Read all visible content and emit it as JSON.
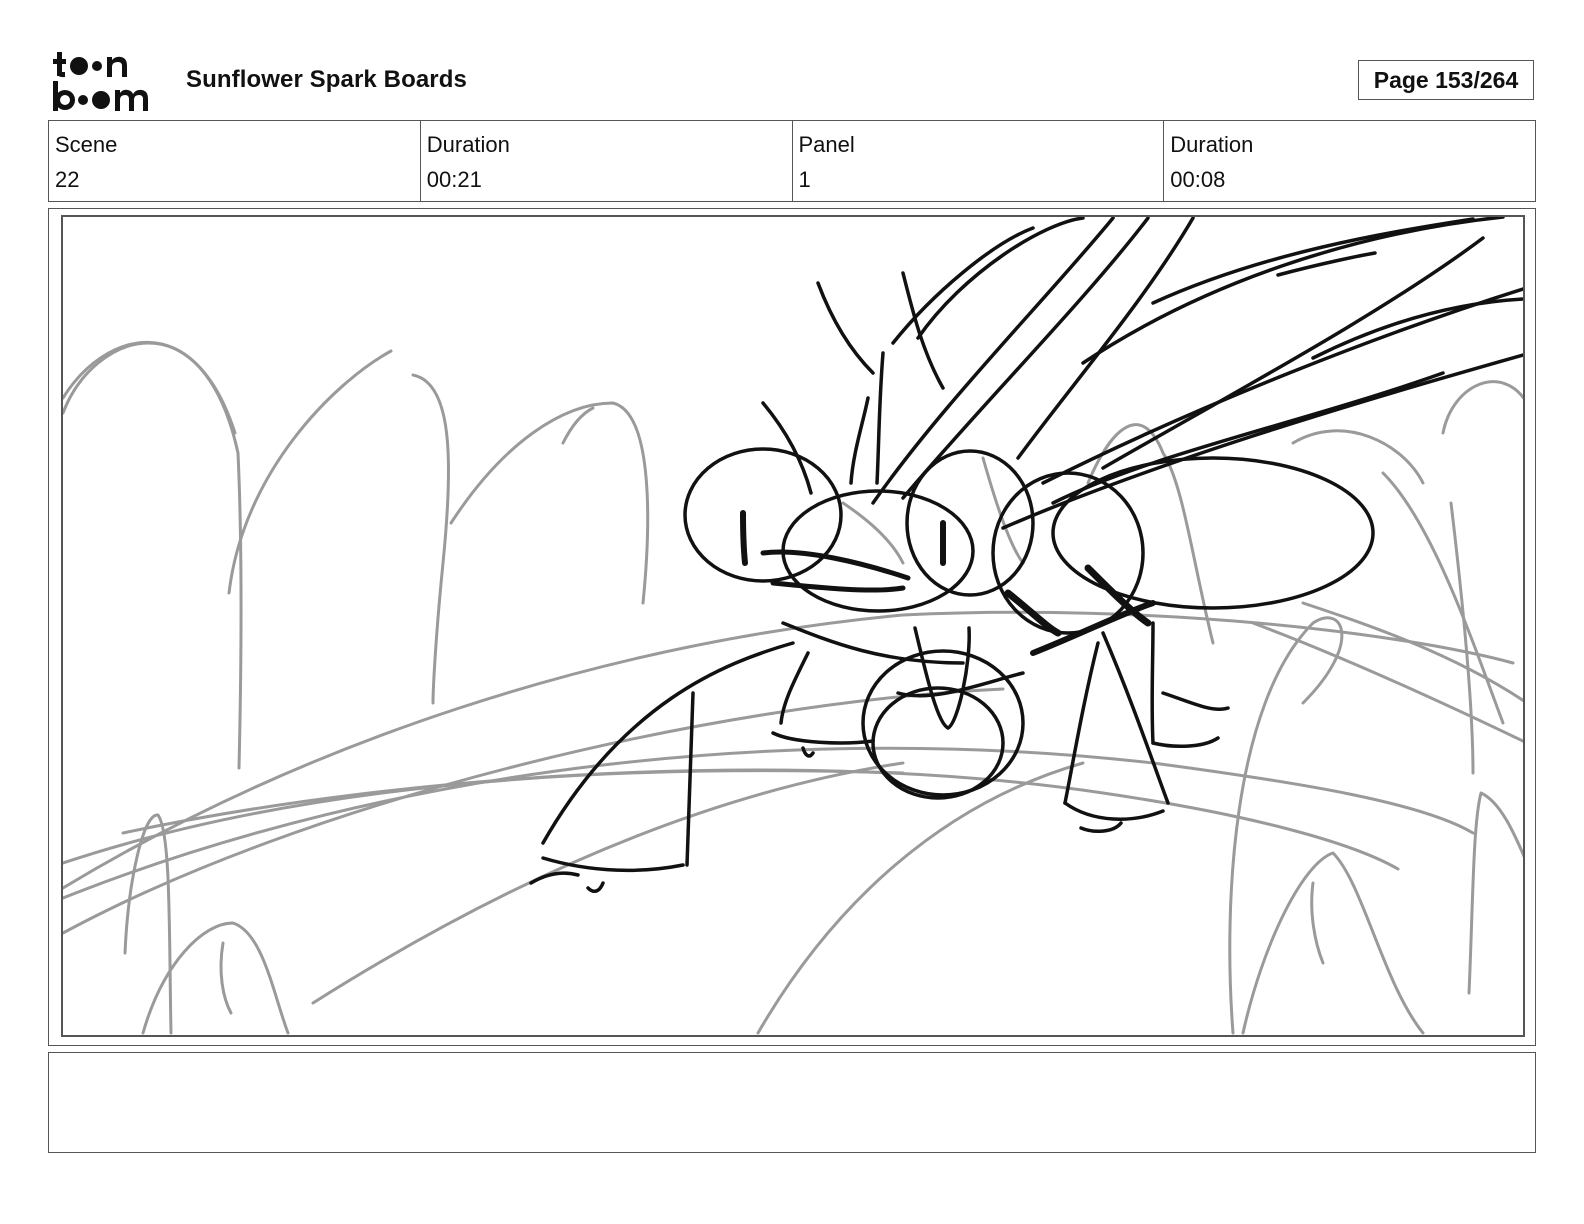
{
  "header": {
    "logo_text_top": "toon",
    "logo_text_bottom": "boom",
    "project_title": "Sunflower Spark Boards",
    "page_indicator": "Page 153/264"
  },
  "info": {
    "scene_label": "Scene",
    "scene_value": "22",
    "scene_duration_label": "Duration",
    "scene_duration_value": "00:21",
    "panel_label": "Panel",
    "panel_value": "1",
    "panel_duration_label": "Duration",
    "panel_duration_value": "00:08"
  },
  "colors": {
    "sketch_ink": "#111111",
    "background_sketch": "#9a9a9a",
    "frame_border": "#555555"
  },
  "notes": {
    "text": ""
  }
}
